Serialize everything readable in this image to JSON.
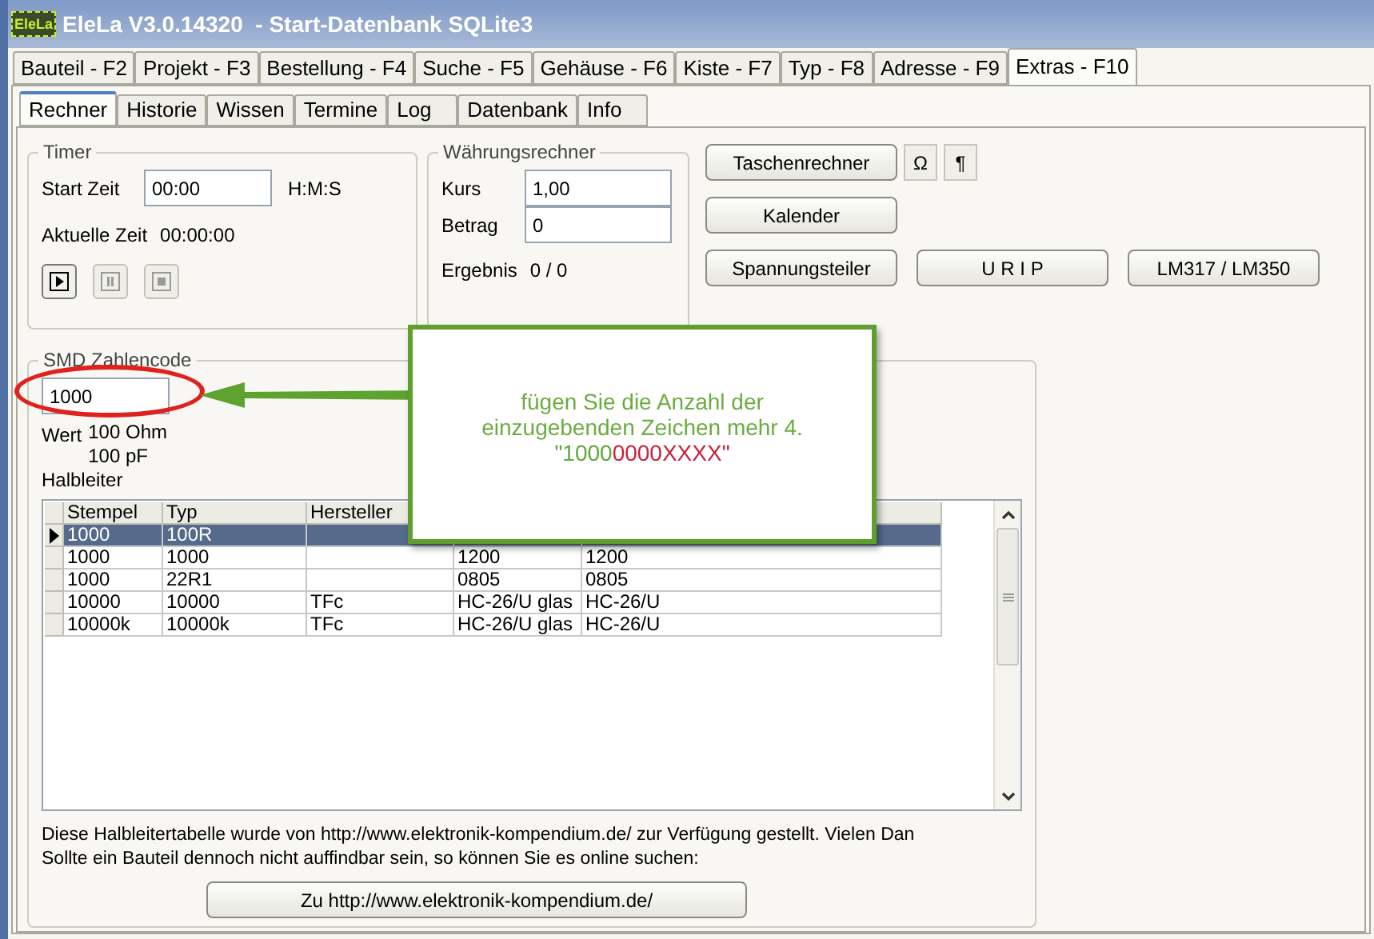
{
  "window": {
    "logo": "EleLa",
    "title": "EleLa V3.0.14320  - Start-Datenbank SQLite3"
  },
  "tabs": [
    {
      "label": "Bauteil - F2",
      "selected": false
    },
    {
      "label": "Projekt - F3",
      "selected": false
    },
    {
      "label": "Bestellung - F4",
      "selected": false
    },
    {
      "label": "Suche - F5",
      "selected": false
    },
    {
      "label": "Gehäuse - F6",
      "selected": false
    },
    {
      "label": "Kiste - F7",
      "selected": false
    },
    {
      "label": "Typ - F8",
      "selected": false
    },
    {
      "label": "Adresse - F9",
      "selected": false
    },
    {
      "label": "Extras - F10",
      "selected": true
    }
  ],
  "subtabs": [
    {
      "label": "Rechner",
      "selected": true
    },
    {
      "label": "Historie",
      "selected": false
    },
    {
      "label": "Wissen",
      "selected": false
    },
    {
      "label": "Termine",
      "selected": false
    },
    {
      "label": "Log",
      "selected": false
    },
    {
      "label": "Datenbank",
      "selected": false
    },
    {
      "label": "Info",
      "selected": false
    }
  ],
  "timer": {
    "title": "Timer",
    "start_label": "Start Zeit",
    "start_value": "00:00",
    "unit": "H:M:S",
    "current_label": "Aktuelle Zeit",
    "current_value": "00:00:00",
    "controls": [
      {
        "kind": "play",
        "disabled": false
      },
      {
        "kind": "pause",
        "disabled": true
      },
      {
        "kind": "stop",
        "disabled": true
      }
    ]
  },
  "currency": {
    "title": "Währungsrechner",
    "fields": [
      {
        "label": "Kurs",
        "value": "1,00"
      },
      {
        "label": "Betrag",
        "value": "0"
      }
    ],
    "result_label": "Ergebnis",
    "result_value": "0 / 0"
  },
  "tools": [
    {
      "buttons": [
        {
          "kind": "button",
          "label": "Taschenrechner"
        },
        {
          "kind": "symbol",
          "label": "Ω"
        },
        {
          "kind": "symbol",
          "label": "¶"
        }
      ]
    },
    {
      "buttons": [
        {
          "kind": "button",
          "label": "Kalender"
        }
      ]
    },
    {
      "buttons": [
        {
          "kind": "button",
          "label": "Spannungsteiler"
        },
        {
          "kind": "button",
          "label": "U R I P"
        },
        {
          "kind": "button",
          "label": "LM317 / LM350"
        }
      ]
    }
  ],
  "smd": {
    "title": "SMD Zahlencode",
    "code_value": "1000",
    "value_label": "Wert",
    "values": [
      "100 Ohm",
      "100 pF"
    ],
    "semiconductor_label": "Halbleiter",
    "table": {
      "columns": [
        "Stempel",
        "Typ",
        "Hersteller"
      ],
      "rows": [
        {
          "selected": true,
          "cells": [
            "1000",
            "100R",
            null,
            null,
            null
          ]
        },
        {
          "selected": false,
          "cells": [
            "1000",
            "1000",
            null,
            "1200",
            "1200"
          ]
        },
        {
          "selected": false,
          "cells": [
            "1000",
            "22R1",
            null,
            "0805",
            "0805"
          ]
        },
        {
          "selected": false,
          "cells": [
            "10000",
            "10000",
            "TFc",
            "HC-26/U glas",
            "HC-26/U"
          ]
        },
        {
          "selected": false,
          "cells": [
            "10000k",
            "10000k",
            "TFc",
            "HC-26/U glas",
            "HC-26/U"
          ]
        }
      ]
    },
    "notes": [
      "Diese Halbleitertabelle wurde von http://www.elektronik-kompendium.de/ zur Verfügung gestellt. Vielen Dan",
      "Sollte ein Bauteil dennoch nicht auffindbar sein, so können Sie es online suchen:"
    ],
    "link_button": "Zu http://www.elektronik-kompendium.de/"
  },
  "callout": {
    "message": "fügen Sie die Anzahl der einzugebenden Zeichen mehr 4.",
    "example": [
      {
        "text": "\"1000",
        "color": "#5ea83a"
      },
      {
        "text": "0000XXXX\"",
        "color": "#cc1f3a"
      }
    ]
  }
}
